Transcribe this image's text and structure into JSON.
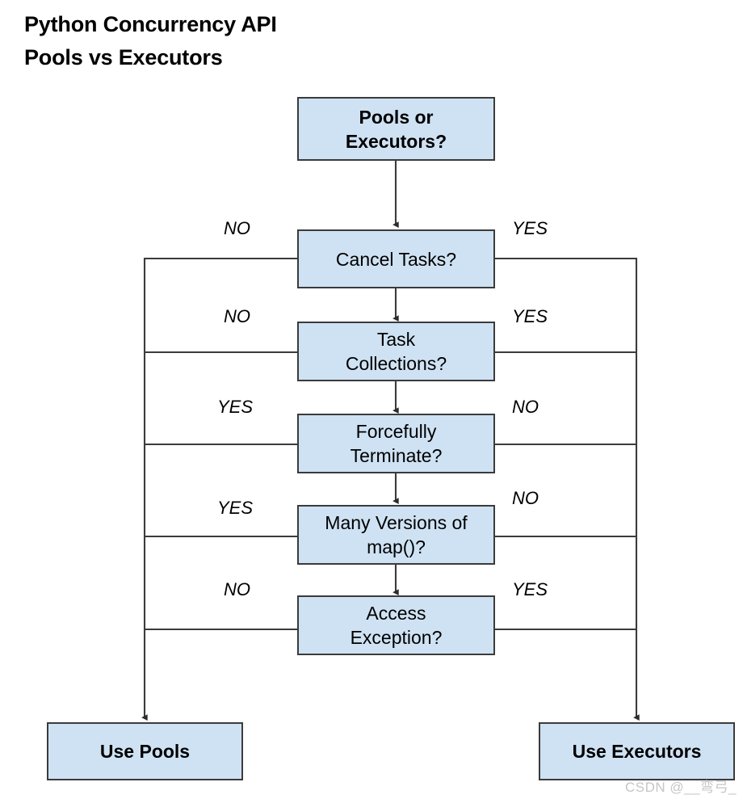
{
  "title": {
    "line1": "Python Concurrency API",
    "line2": "Pools vs Executors"
  },
  "colors": {
    "node_fill": "#cfe2f3",
    "node_border": "#3b3b3b",
    "connector": "#3b3b3b",
    "text": "#000000",
    "watermark": "#c6c6c6",
    "background": "#ffffff"
  },
  "flowchart": {
    "type": "decision-flowchart",
    "start": "Pools or Executors?",
    "decisions": [
      {
        "label": "Cancel Tasks?",
        "left_label": "NO",
        "right_label": "YES",
        "left_target": "Use Pools",
        "right_target": "Use Executors"
      },
      {
        "label_line1": "Task",
        "label_line2": "Collections?",
        "left_label": "NO",
        "right_label": "YES",
        "left_target": "Use Pools",
        "right_target": "Use Executors"
      },
      {
        "label_line1": "Forcefully",
        "label_line2": "Terminate?",
        "left_label": "YES",
        "right_label": "NO",
        "left_target": "Use Pools",
        "right_target": "Use Executors"
      },
      {
        "label_line1": "Many Versions of",
        "label_line2": "map()?",
        "left_label": "YES",
        "right_label": "NO",
        "left_target": "Use Pools",
        "right_target": "Use Executors"
      },
      {
        "label_line1": "Access",
        "label_line2": "Exception?",
        "left_label": "NO",
        "right_label": "YES",
        "left_target": "Use Pools",
        "right_target": "Use Executors"
      }
    ],
    "terminals": {
      "left": "Use Pools",
      "right": "Use Executors"
    }
  },
  "nodes": {
    "start": {
      "line1": "Pools or",
      "line2": "Executors?"
    },
    "cancel_tasks": {
      "line1": "Cancel Tasks?"
    },
    "task_collections": {
      "line1": "Task",
      "line2": "Collections?"
    },
    "forcefully_terminate": {
      "line1": "Forcefully",
      "line2": "Terminate?"
    },
    "many_versions_map": {
      "line1": "Many Versions of",
      "line2": "map()?"
    },
    "access_exception": {
      "line1": "Access",
      "line2": "Exception?"
    },
    "use_pools": {
      "line1": "Use Pools"
    },
    "use_executors": {
      "line1": "Use Executors"
    }
  },
  "edge_labels": {
    "row1_left": "NO",
    "row1_right": "YES",
    "row2_left": "NO",
    "row2_right": "YES",
    "row3_left": "YES",
    "row3_right": "NO",
    "row4_left": "YES",
    "row4_right": "NO",
    "row5_left": "NO",
    "row5_right": "YES"
  },
  "watermark": "CSDN @__弯弓_"
}
